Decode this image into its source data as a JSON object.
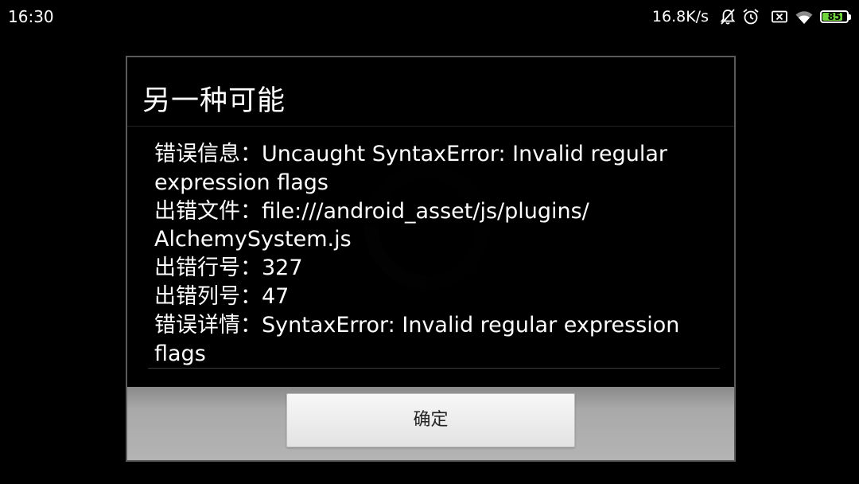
{
  "status_bar": {
    "time": "16:30",
    "net_speed": "16.8K/s",
    "icons": [
      "mute-bell-icon",
      "alarm-icon",
      "sim-off-icon",
      "wifi-icon"
    ],
    "battery_level": "85",
    "battery_percent": 85,
    "battery_color": "#6fd43b"
  },
  "dialog": {
    "title": "另一种可能",
    "lines": [
      "错误信息：Uncaught SyntaxError: Invalid regular",
      "expression flags",
      "出错文件：file:///android_asset/js/plugins/",
      "AlchemySystem.js",
      "出错行号：327",
      "出错列号：47",
      "错误详情：SyntaxError: Invalid regular expression",
      "flags"
    ],
    "confirm_label": "确定"
  }
}
